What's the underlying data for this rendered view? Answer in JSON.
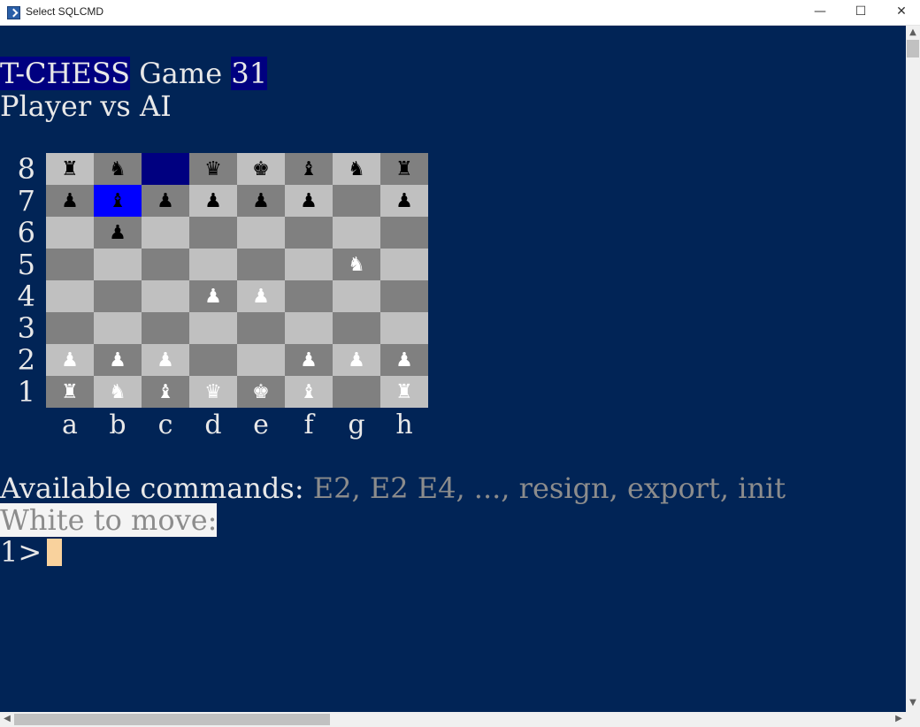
{
  "window": {
    "title": "Select SQLCMD",
    "min_glyph": "—",
    "max_glyph": "☐",
    "close_glyph": "✕"
  },
  "console": {
    "title_app": "T-CHESS",
    "title_mid": " Game ",
    "title_game_no": "31",
    "subtitle": "Player vs AI",
    "commands_label": "Available commands: ",
    "commands_list": "E2, E2 E4, ..., resign, export, init",
    "turn_prompt": "White to move:",
    "input_prompt": "1>"
  },
  "board": {
    "ranks": [
      "8",
      "7",
      "6",
      "5",
      "4",
      "3",
      "2",
      "1"
    ],
    "files": [
      "a",
      "b",
      "c",
      "d",
      "e",
      "f",
      "g",
      "h"
    ],
    "squares": [
      [
        {
          "c": "light",
          "p": "♜",
          "s": "b"
        },
        {
          "c": "dark",
          "p": "♞",
          "s": "b"
        },
        {
          "c": "sel-dark",
          "p": "",
          "s": ""
        },
        {
          "c": "dark",
          "p": "♛",
          "s": "b"
        },
        {
          "c": "light",
          "p": "♚",
          "s": "b"
        },
        {
          "c": "dark",
          "p": "♝",
          "s": "b"
        },
        {
          "c": "light",
          "p": "♞",
          "s": "b"
        },
        {
          "c": "dark",
          "p": "♜",
          "s": "b"
        }
      ],
      [
        {
          "c": "dark",
          "p": "♟",
          "s": "b"
        },
        {
          "c": "sel-blue",
          "p": "♝",
          "s": "b"
        },
        {
          "c": "dark",
          "p": "♟",
          "s": "b"
        },
        {
          "c": "light",
          "p": "♟",
          "s": "b"
        },
        {
          "c": "dark",
          "p": "♟",
          "s": "b"
        },
        {
          "c": "light",
          "p": "♟",
          "s": "b"
        },
        {
          "c": "dark",
          "p": "",
          "s": ""
        },
        {
          "c": "light",
          "p": "♟",
          "s": "b"
        }
      ],
      [
        {
          "c": "light",
          "p": "",
          "s": ""
        },
        {
          "c": "dark",
          "p": "♟",
          "s": "b"
        },
        {
          "c": "light",
          "p": "",
          "s": ""
        },
        {
          "c": "dark",
          "p": "",
          "s": ""
        },
        {
          "c": "light",
          "p": "",
          "s": ""
        },
        {
          "c": "dark",
          "p": "",
          "s": ""
        },
        {
          "c": "light",
          "p": "",
          "s": ""
        },
        {
          "c": "dark",
          "p": "",
          "s": ""
        }
      ],
      [
        {
          "c": "dark",
          "p": "",
          "s": ""
        },
        {
          "c": "light",
          "p": "",
          "s": ""
        },
        {
          "c": "dark",
          "p": "",
          "s": ""
        },
        {
          "c": "light",
          "p": "",
          "s": ""
        },
        {
          "c": "dark",
          "p": "",
          "s": ""
        },
        {
          "c": "light",
          "p": "",
          "s": ""
        },
        {
          "c": "dark",
          "p": "♞",
          "s": "w"
        },
        {
          "c": "light",
          "p": "",
          "s": ""
        }
      ],
      [
        {
          "c": "light",
          "p": "",
          "s": ""
        },
        {
          "c": "dark",
          "p": "",
          "s": ""
        },
        {
          "c": "light",
          "p": "",
          "s": ""
        },
        {
          "c": "dark",
          "p": "♟",
          "s": "w"
        },
        {
          "c": "light",
          "p": "♟",
          "s": "w"
        },
        {
          "c": "dark",
          "p": "",
          "s": ""
        },
        {
          "c": "light",
          "p": "",
          "s": ""
        },
        {
          "c": "dark",
          "p": "",
          "s": ""
        }
      ],
      [
        {
          "c": "dark",
          "p": "",
          "s": ""
        },
        {
          "c": "light",
          "p": "",
          "s": ""
        },
        {
          "c": "dark",
          "p": "",
          "s": ""
        },
        {
          "c": "light",
          "p": "",
          "s": ""
        },
        {
          "c": "dark",
          "p": "",
          "s": ""
        },
        {
          "c": "light",
          "p": "",
          "s": ""
        },
        {
          "c": "dark",
          "p": "",
          "s": ""
        },
        {
          "c": "light",
          "p": "",
          "s": ""
        }
      ],
      [
        {
          "c": "light",
          "p": "♟",
          "s": "w"
        },
        {
          "c": "dark",
          "p": "♟",
          "s": "w"
        },
        {
          "c": "light",
          "p": "♟",
          "s": "w"
        },
        {
          "c": "dark",
          "p": "",
          "s": ""
        },
        {
          "c": "light",
          "p": "",
          "s": ""
        },
        {
          "c": "dark",
          "p": "♟",
          "s": "w"
        },
        {
          "c": "light",
          "p": "♟",
          "s": "w"
        },
        {
          "c": "dark",
          "p": "♟",
          "s": "w"
        }
      ],
      [
        {
          "c": "dark",
          "p": "♜",
          "s": "w"
        },
        {
          "c": "light",
          "p": "♞",
          "s": "w"
        },
        {
          "c": "dark",
          "p": "♝",
          "s": "w"
        },
        {
          "c": "light",
          "p": "♛",
          "s": "w"
        },
        {
          "c": "dark",
          "p": "♚",
          "s": "w"
        },
        {
          "c": "light",
          "p": "♝",
          "s": "w"
        },
        {
          "c": "dark",
          "p": "",
          "s": ""
        },
        {
          "c": "light",
          "p": "♜",
          "s": "w"
        }
      ]
    ]
  },
  "colors": {
    "console_bg": "#012456",
    "light_square": "#c0c0c0",
    "dark_square": "#808080",
    "highlight_navy": "#000080",
    "highlight_blue": "#0000ff",
    "cursor": "#f9d29d"
  },
  "icons": {
    "app": "powershell-icon",
    "minimize": "minimize-icon",
    "maximize": "maximize-icon",
    "close": "close-icon"
  },
  "scroll": {
    "up": "▲",
    "down": "▼",
    "left": "◀",
    "right": "▶"
  }
}
